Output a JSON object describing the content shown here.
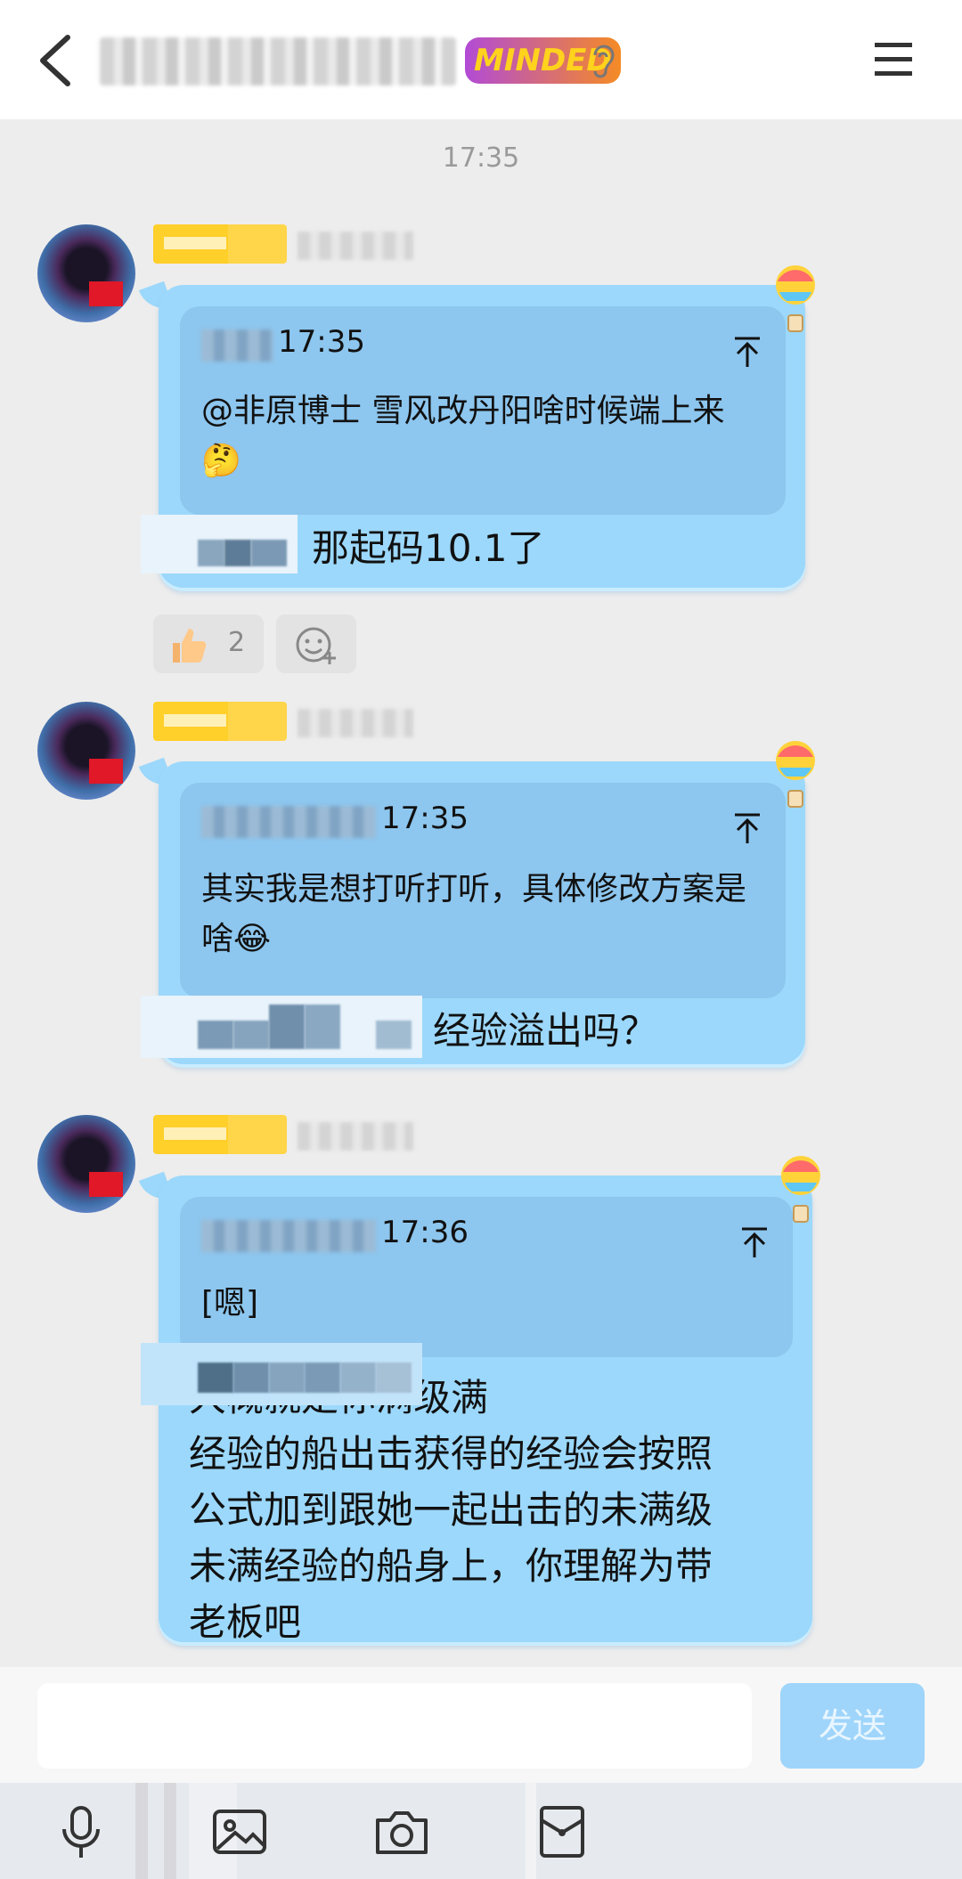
{
  "header": {
    "badge": "MINDED"
  },
  "time_divider": "17:35",
  "messages": [
    {
      "quote_time": "17:35",
      "quote_text": "@非原博士 雪风改丹阳啥时候端上来 🤔",
      "text": "那起码10.1了",
      "reaction_count": "2"
    },
    {
      "quote_time": "17:35",
      "quote_text": "其实我是想打听打听，具体修改方案是啥😂",
      "text": "经验溢出吗？"
    },
    {
      "quote_time": "17:36",
      "quote_text": "[嗯]",
      "text": "大概就是你满级满\n经验的船出击获得的经验会按照\n公式加到跟她一起出击的未满级\n未满经验的船身上，你理解为带\n老板吧"
    }
  ],
  "input": {
    "send_label": "发送",
    "placeholder": ""
  },
  "colors": {
    "bubble": "#9cd8fb",
    "quote": "#8dc6ee",
    "send_button": "#9fd5fb"
  },
  "icons": [
    "back-arrow-icon",
    "ear-icon",
    "menu-icon",
    "pin-to-top-icon",
    "balloon-icon",
    "thumbs-up-icon",
    "add-reaction-icon",
    "microphone-icon",
    "image-icon",
    "camera-icon",
    "red-packet-icon"
  ]
}
